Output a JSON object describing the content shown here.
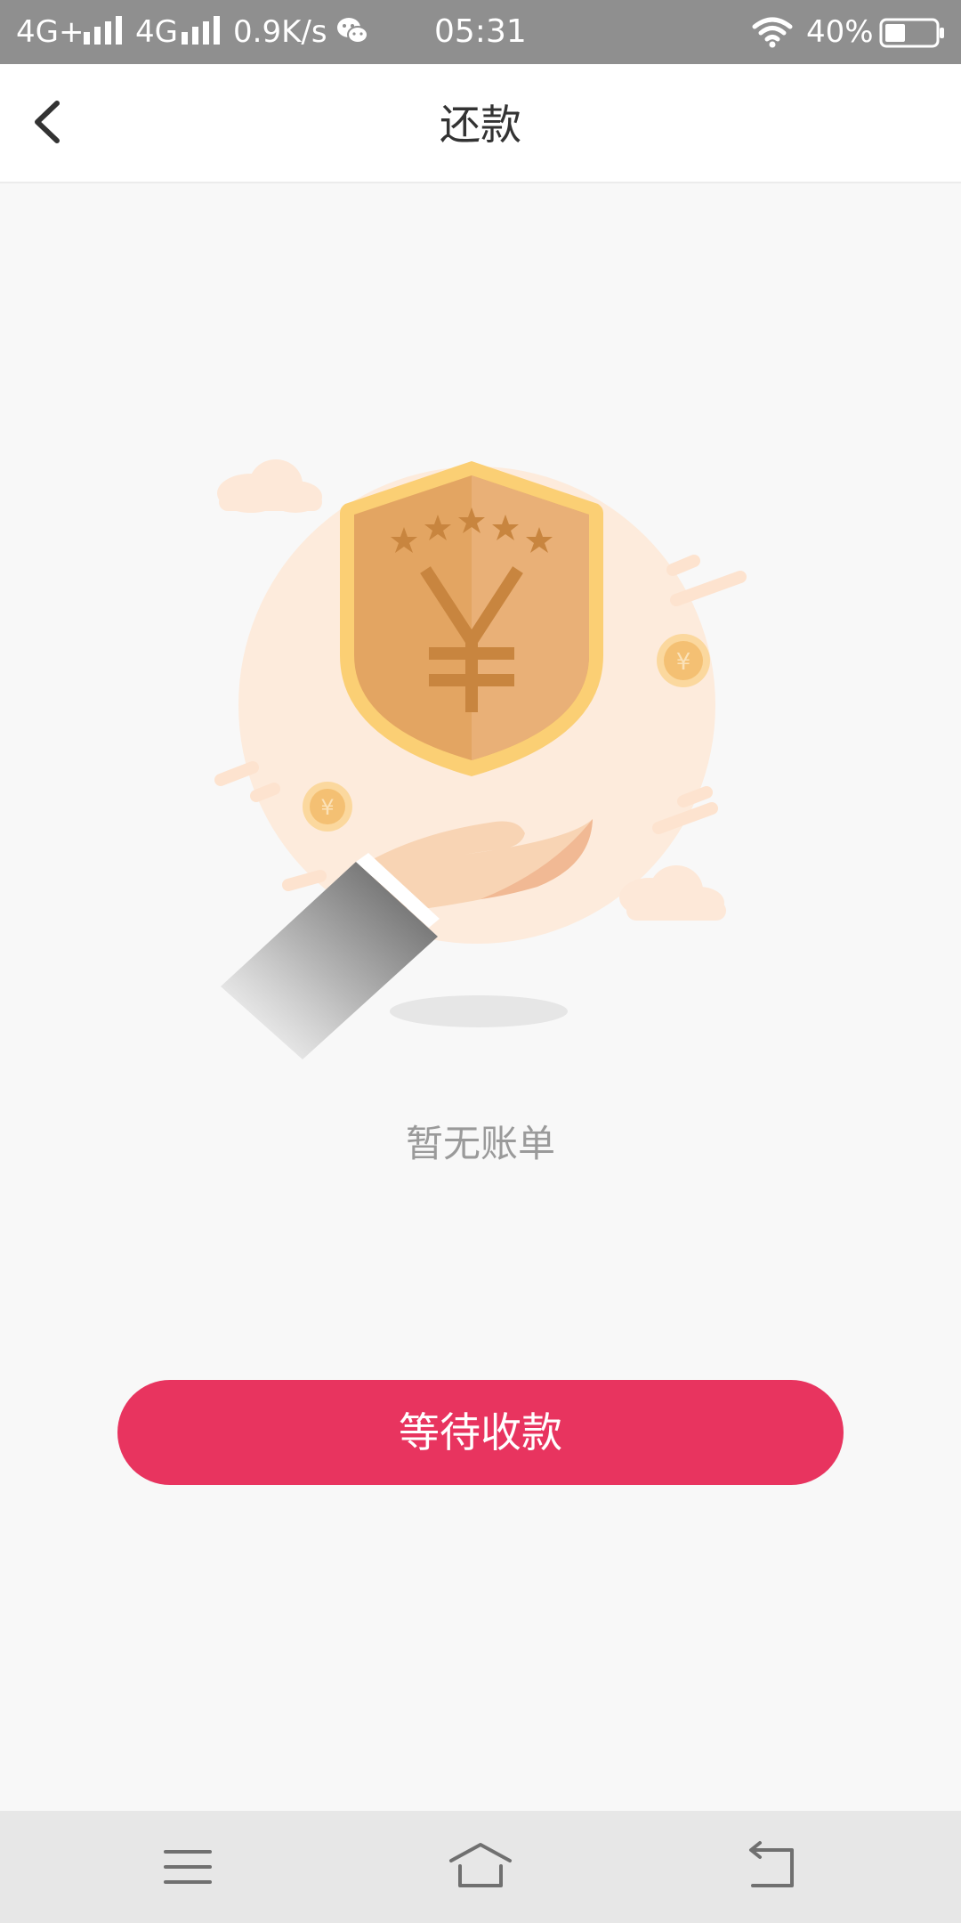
{
  "status_bar": {
    "network1": "4G+",
    "network2": "4G",
    "speed": "0.9K/s",
    "time": "05:31",
    "battery_percent": "40%",
    "battery_level": 0.4,
    "icons": [
      "signal-icon",
      "wechat-icon",
      "wifi-icon",
      "battery-icon"
    ]
  },
  "header": {
    "title": "还款",
    "back_icon": "chevron-left-icon"
  },
  "main": {
    "illustration": "shield-coin-hand-illustration",
    "empty_text": "暂无账单",
    "action_button_label": "等待收款"
  },
  "nav_bar": {
    "icons": [
      "menu-icon",
      "home-icon",
      "back-icon"
    ]
  },
  "colors": {
    "status_bar_bg": "#8f8f8f",
    "accent": "#e8345f",
    "page_bg": "#f8f8f8",
    "nav_bg": "#e7e7e7",
    "shield_gold": "#f2b45a"
  }
}
